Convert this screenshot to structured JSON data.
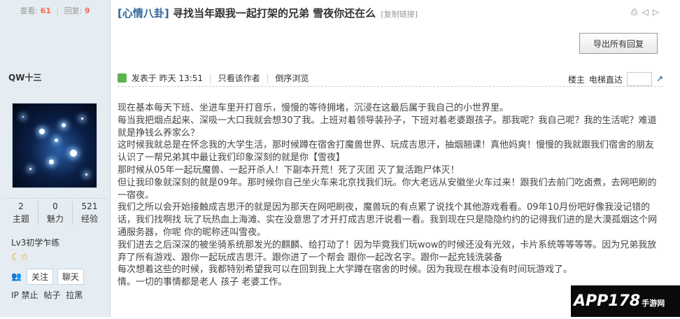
{
  "sidebar": {
    "views_label": "查看:",
    "views": "61",
    "replies_label": "回复:",
    "replies": "9",
    "author": "QW十三",
    "stats": [
      {
        "value": "2",
        "label": "主题"
      },
      {
        "value": "0",
        "label": "魅力"
      },
      {
        "value": "521",
        "label": "经验"
      }
    ],
    "level": "Lv3初学乍练",
    "follow_label": "关注",
    "chat_label": "聊天",
    "ip_ban": "IP 禁止",
    "posts": "帖子",
    "blacklist": "拉黑"
  },
  "thread": {
    "category": "[心情八卦]",
    "title": "寻找当年跟我一起打架的兄弟 雪夜你还在么",
    "copy_link": "[复制链接]",
    "export_label": "导出所有回复"
  },
  "post_head": {
    "posted": "发表于 昨天 13:51",
    "author_only": "只看该作者",
    "reverse": "倒序浏览",
    "floor": "楼主",
    "elevator": "电梯直达"
  },
  "content": [
    "现在基本每天下班、坐进车里开打音乐，慢慢的等待拥堵，沉浸在这最后属于我自己的小世界里。",
    "每当我把烟点起来、深吸一大口我就会想30了我。上班对着领导装孙子，下班对着老婆跟孩子。那我呢？我自己呢？我的生活呢？难道就是挣钱么养家么？",
    "这时候我就总是在怀念我的大学生活，那时候蹲在宿舍打魔兽世界、玩成吉思汗，抽烟翘课！真他妈爽！慢慢的我就跟我们宿舍的朋友认识了一帮兄弟其中最让我们印象深刻的就是你【雪夜】",
    "那时候从05年一起玩魔兽、一起开杀人！下副本开荒！死了灭团 灭了复活跑尸体灭！",
    "但让我印象就深刻的就是09年。那时候你自己坐火车来北京找我们玩。你大老远从安徽坐火车过来！跟我们去前门吃卤煮，去网吧刷的一宿夜。",
    "我们之所以会开始接触成吉思汗的就是因为那天在网吧刷夜，魔兽玩的有点累了说找个其他游戏看看。09年10月份吧好像我没记错的话，我们找啊找 玩了玩热血上海滩、实在没意思了才开打成吉思汗说看一看。我到现在只是隐隐约约的记得我们进的是大漠孤烟这个网通服务器，你呢 你的昵称还叫雪夜。",
    "我们进去之后深深的被坐骑系统那发光的麒麟、给打动了！因为毕竟我们玩wow的时候还没有光效，卡片系统等等等等。因为兄弟我放弃了所有游戏、跟你一起玩成吉思汗。跟你进了一个帮会 跟你一起改名字。跟你一起充钱洗装备",
    "每次想着这些的时候，我都特别希望我可以在回到我上大学蹲在宿舍的时候。因为我现在根本没有时间玩游戏了。",
    "情。一切的事情都是老人 孩子 老婆工作。"
  ],
  "watermark": {
    "brand": "APP178",
    "sub": "手游网"
  },
  "colors": {
    "sidebar_bg": "#e5edf2",
    "category": "#336699",
    "highlight_num": "#f26c4f"
  }
}
